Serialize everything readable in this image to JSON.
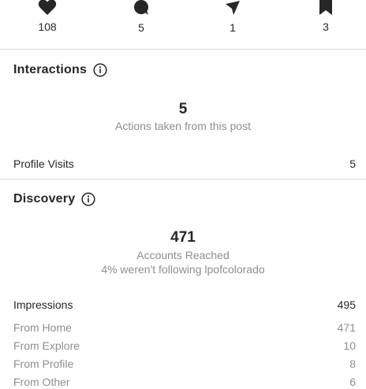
{
  "stats": [
    {
      "icon": "heart-icon",
      "value": "108"
    },
    {
      "icon": "comment-icon",
      "value": "5"
    },
    {
      "icon": "share-icon",
      "value": "1"
    },
    {
      "icon": "bookmark-icon",
      "value": "3"
    }
  ],
  "interactions": {
    "title": "Interactions",
    "count": "5",
    "caption": "Actions taken from this post",
    "rows": [
      {
        "label": "Profile Visits",
        "value": "5"
      }
    ]
  },
  "discovery": {
    "title": "Discovery",
    "count": "471",
    "caption_1": "Accounts Reached",
    "caption_2": "4% weren't following lpofcolorado",
    "impressions": {
      "label": "Impressions",
      "value": "495"
    },
    "sources": [
      {
        "label": "From Home",
        "value": "471"
      },
      {
        "label": "From Explore",
        "value": "10"
      },
      {
        "label": "From Profile",
        "value": "8"
      },
      {
        "label": "From Other",
        "value": "6"
      }
    ]
  }
}
